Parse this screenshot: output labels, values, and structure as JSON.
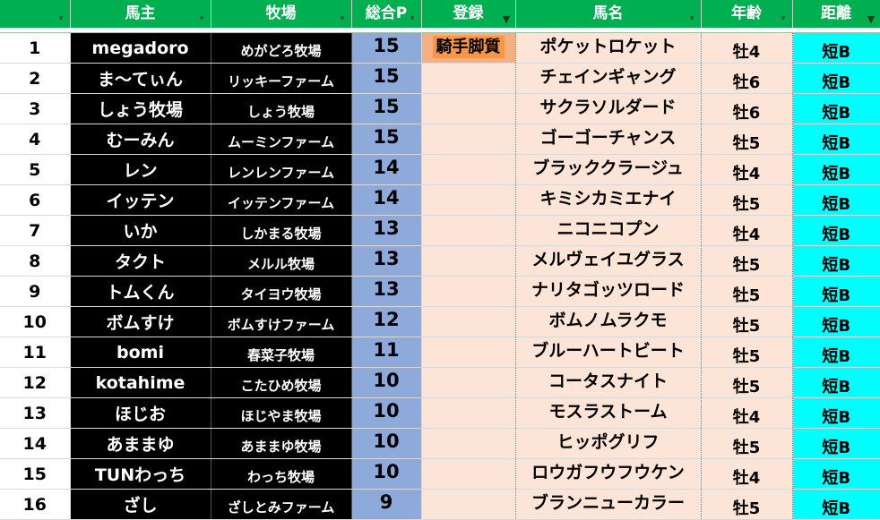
{
  "headers": {
    "num": "",
    "owner": "馬主",
    "farm": "牧場",
    "points": "総合P",
    "registration": "登録",
    "horse": "馬名",
    "age": "年齢",
    "distance": "距離"
  },
  "rows": [
    {
      "num": "1",
      "owner": "megadoro",
      "farm": "めがどろ牧場",
      "points": "15",
      "registration": "騎手脚質",
      "horse": "ポケットロケット",
      "age": "牡4",
      "distance": "短B"
    },
    {
      "num": "2",
      "owner": "ま〜てぃん",
      "farm": "リッキーファーム",
      "points": "15",
      "registration": "",
      "horse": "チェインギャング",
      "age": "牡6",
      "distance": "短B"
    },
    {
      "num": "3",
      "owner": "しょう牧場",
      "farm": "しょう牧場",
      "points": "15",
      "registration": "",
      "horse": "サクラソルダード",
      "age": "牡6",
      "distance": "短B"
    },
    {
      "num": "4",
      "owner": "むーみん",
      "farm": "ムーミンファーム",
      "points": "15",
      "registration": "",
      "horse": "ゴーゴーチャンス",
      "age": "牡5",
      "distance": "短B"
    },
    {
      "num": "5",
      "owner": "レン",
      "farm": "レンレンファーム",
      "points": "14",
      "registration": "",
      "horse": "ブラッククラージュ",
      "age": "牡4",
      "distance": "短B"
    },
    {
      "num": "6",
      "owner": "イッテン",
      "farm": "イッテンファーム",
      "points": "14",
      "registration": "",
      "horse": "キミシカミエナイ",
      "age": "牡5",
      "distance": "短B"
    },
    {
      "num": "7",
      "owner": "いか",
      "farm": "しかまる牧場",
      "points": "13",
      "registration": "",
      "horse": "ニコニコプン",
      "age": "牡4",
      "distance": "短B"
    },
    {
      "num": "8",
      "owner": "タクト",
      "farm": "メルル牧場",
      "points": "13",
      "registration": "",
      "horse": "メルヴェイユグラス",
      "age": "牡5",
      "distance": "短B"
    },
    {
      "num": "9",
      "owner": "トムくん",
      "farm": "タイヨウ牧場",
      "points": "13",
      "registration": "",
      "horse": "ナリタゴッツロード",
      "age": "牡5",
      "distance": "短B"
    },
    {
      "num": "10",
      "owner": "ボムすけ",
      "farm": "ボムすけファーム",
      "points": "12",
      "registration": "",
      "horse": "ボムノムラクモ",
      "age": "牡5",
      "distance": "短B"
    },
    {
      "num": "11",
      "owner": "bomi",
      "farm": "春菜子牧場",
      "points": "11",
      "registration": "",
      "horse": "ブルーハートビート",
      "age": "牡5",
      "distance": "短B"
    },
    {
      "num": "12",
      "owner": "kotahime",
      "farm": "こたひめ牧場",
      "points": "10",
      "registration": "",
      "horse": "コータスナイト",
      "age": "牡5",
      "distance": "短B"
    },
    {
      "num": "13",
      "owner": "ほじお",
      "farm": "ほじやま牧場",
      "points": "10",
      "registration": "",
      "horse": "モスラストーム",
      "age": "牡4",
      "distance": "短B"
    },
    {
      "num": "14",
      "owner": "あままゆ",
      "farm": "あままゆ牧場",
      "points": "10",
      "registration": "",
      "horse": "ヒッポグリフ",
      "age": "牡5",
      "distance": "短B"
    },
    {
      "num": "15",
      "owner": "TUNわっち",
      "farm": "わっち牧場",
      "points": "10",
      "registration": "",
      "horse": "ロウガフウフウケン",
      "age": "牡4",
      "distance": "短B"
    },
    {
      "num": "16",
      "owner": "ざし",
      "farm": "ざしとみファーム",
      "points": "9",
      "registration": "",
      "horse": "ブランニューカラー",
      "age": "牡5",
      "distance": "短B"
    }
  ],
  "filters": {
    "inactive_icon": "▾",
    "active_icon": "▼",
    "active_columns": [
      "registration",
      "distance"
    ]
  },
  "colors": {
    "header_green": "#00b050",
    "owner_black": "#000000",
    "points_blue": "#8eaadb",
    "peach": "#fce4d6",
    "badge_orange": "#f79646",
    "distance_cyan": "#00ffff"
  }
}
